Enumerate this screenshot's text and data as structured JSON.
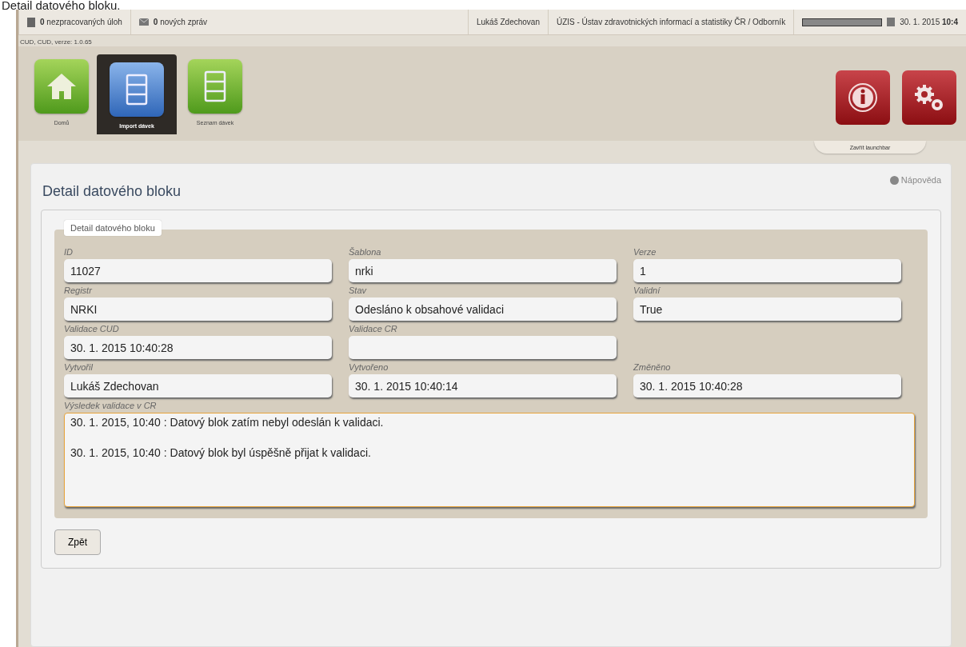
{
  "caption": "Detail datového bloku.",
  "top_bar": {
    "tasks": {
      "count": "0",
      "label": "nezpracovaných úloh"
    },
    "messages": {
      "count": "0",
      "label": "nových zpráv"
    },
    "user": "Lukáš Zdechovan",
    "organization": "ÚZIS - Ústav zdravotnických informací a statistiky ČR / Odborník",
    "progress": {
      "level": 1
    },
    "date": "30. 1. 2015",
    "time": "10:4"
  },
  "version": "CUD, CUD, verze: 1.0.65",
  "launchbar": {
    "tiles": [
      {
        "label": "Domů",
        "kind": "home",
        "selected": false
      },
      {
        "label": "Import dávek",
        "kind": "list-blue",
        "selected": true
      },
      {
        "label": "Seznam dávek",
        "kind": "list-green",
        "selected": false
      }
    ],
    "right_tiles": [
      {
        "kind": "info"
      },
      {
        "kind": "gears"
      }
    ],
    "close_label": "Zavřít launchbar"
  },
  "page": {
    "title": "Detail datového bloku",
    "help": "Nápověda",
    "legend": "Detail datového bloku",
    "rows": [
      [
        {
          "label": "ID",
          "value": "11027"
        },
        {
          "label": "Šablona",
          "value": "nrki"
        },
        {
          "label": "Verze",
          "value": "1"
        }
      ],
      [
        {
          "label": "Registr",
          "value": "NRKI"
        },
        {
          "label": "Stav",
          "value": "Odesláno k obsahové validaci"
        },
        {
          "label": "Validní",
          "value": "True"
        }
      ],
      [
        {
          "label": "Validace CUD",
          "value": "30. 1. 2015 10:40:28"
        },
        {
          "label": "Validace CR"
        }
      ],
      [
        {
          "label": "Vytvořil",
          "value": "Lukáš Zdechovan"
        },
        {
          "label": "Vytvořeno",
          "value": "30. 1. 2015 10:40:14"
        },
        {
          "label": "Změněno",
          "value": "30. 1. 2015 10:40:28"
        }
      ]
    ],
    "result": {
      "label": "Výsledek validace v CR",
      "lines": [
        "30. 1. 2015, 10:40 : Datový blok zatím nebyl odeslán k validaci.",
        "30. 1. 2015, 10:40 : Datový blok byl úspěšně přijat k validaci."
      ]
    },
    "back_button": "Zpět"
  }
}
